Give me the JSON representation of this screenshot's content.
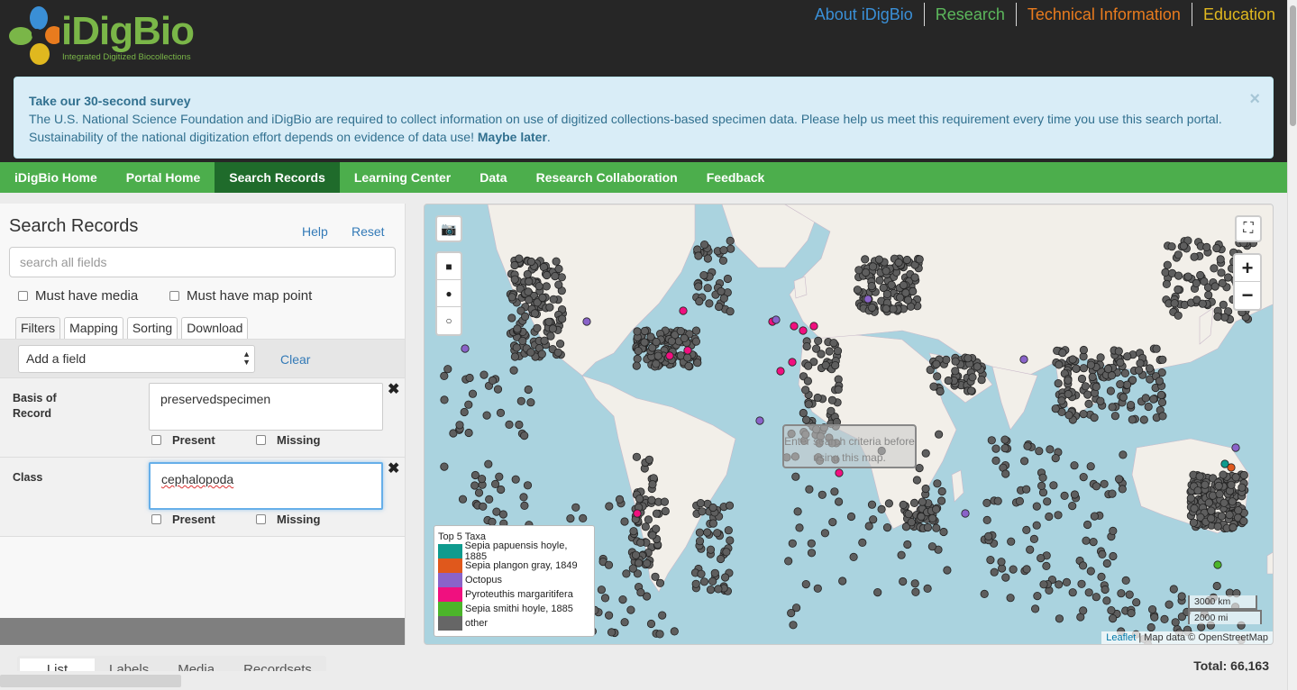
{
  "logo": {
    "wordmark": "iDigBio",
    "tagline": "Integrated Digitized Biocollections"
  },
  "topnav": [
    {
      "label": "About iDigBio",
      "color": "#3a8fd6"
    },
    {
      "label": "Research",
      "color": "#5cb85c"
    },
    {
      "label": "Technical Information",
      "color": "#e87b1e"
    },
    {
      "label": "Education",
      "color": "#e0b81f"
    }
  ],
  "survey": {
    "title": "Take our 30-second survey",
    "body": "The U.S. National Science Foundation and iDigBio are required to collect information on use of digitized collections-based specimen data. Please help us meet this requirement every time you use this search portal. Sustainability of the national digitization effort depends on evidence of data use!",
    "later": "Maybe later",
    "close": "×"
  },
  "mainnav": [
    {
      "label": "iDigBio Home",
      "active": false
    },
    {
      "label": "Portal Home",
      "active": false
    },
    {
      "label": "Search Records",
      "active": true
    },
    {
      "label": "Learning Center",
      "active": false
    },
    {
      "label": "Data",
      "active": false
    },
    {
      "label": "Research Collaboration",
      "active": false
    },
    {
      "label": "Feedback",
      "active": false
    }
  ],
  "panel": {
    "title": "Search Records",
    "help": "Help",
    "reset": "Reset",
    "search_placeholder": "search all fields",
    "must_media": "Must have media",
    "must_map": "Must have map point",
    "tabs": [
      "Filters",
      "Mapping",
      "Sorting",
      "Download"
    ],
    "add_field": "Add a field",
    "clear": "Clear",
    "filters": [
      {
        "label": "Basis of Record",
        "value": "preservedspecimen",
        "present": "Present",
        "missing": "Missing"
      },
      {
        "label": "Class",
        "value": "cephalopoda",
        "present": "Present",
        "missing": "Missing"
      }
    ]
  },
  "map": {
    "hint": "Enter search criteria before using this map.",
    "zoom_in": "+",
    "zoom_out": "−",
    "legend_title": "Top 5 Taxa",
    "legend": [
      {
        "label": "Sepia papuensis hoyle, 1885",
        "color": "#0f9b8e"
      },
      {
        "label": "Sepia plangon gray, 1849",
        "color": "#e0581c"
      },
      {
        "label": "Octopus",
        "color": "#8a63c9"
      },
      {
        "label": "Pyroteuthis margaritifera",
        "color": "#f0107f"
      },
      {
        "label": "Sepia smithi hoyle, 1885",
        "color": "#4cb52a"
      },
      {
        "label": "other",
        "color": "#666666"
      }
    ],
    "scale_km": "3000 km",
    "scale_mi": "2000 mi",
    "attribution_link": "Leaflet",
    "attribution_text": " | Map data © OpenStreetMap",
    "icons": [
      "camera-icon",
      "square-icon",
      "filled-circle-icon",
      "circle-icon",
      "fullscreen-icon"
    ]
  },
  "bottom": {
    "tabs": [
      "List",
      "Labels",
      "Media",
      "Recordsets"
    ],
    "total": "Total: 66,163"
  }
}
